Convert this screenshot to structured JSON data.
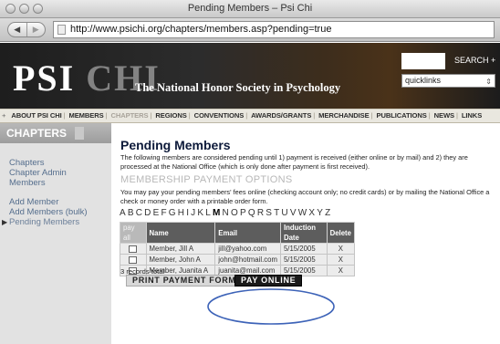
{
  "window": {
    "title": "Pending Members – Psi Chi"
  },
  "toolbar": {
    "back_label": "◀",
    "forward_label": "▶",
    "url": "http://www.psichi.org/chapters/members.asp?pending=true"
  },
  "banner": {
    "logo_psi": "PSI",
    "logo_chi": "CHI",
    "tagline": "The National Honor Society in Psychology",
    "search_label": "SEARCH +",
    "quicklinks_value": "quicklinks"
  },
  "nav": {
    "lead": "+",
    "items": [
      {
        "label": "ABOUT PSI CHI",
        "active": false
      },
      {
        "label": "MEMBERS",
        "active": false
      },
      {
        "label": "CHAPTERS",
        "active": true
      },
      {
        "label": "REGIONS",
        "active": false
      },
      {
        "label": "CONVENTIONS",
        "active": false
      },
      {
        "label": "AWARDS/GRANTS",
        "active": false
      },
      {
        "label": "MERCHANDISE",
        "active": false
      },
      {
        "label": "PUBLICATIONS",
        "active": false
      },
      {
        "label": "NEWS",
        "active": false
      },
      {
        "label": "LINKS",
        "active": false
      }
    ]
  },
  "sidebar": {
    "heading": "CHAPTERS",
    "links": [
      "Chapters",
      "Chapter Admin",
      "Members",
      "Add Member",
      "Add Members (bulk)",
      "Pending Members"
    ]
  },
  "main": {
    "title": "Pending Members",
    "intro": "The following members are considered pending until 1) payment is received (either online or by mail) and 2) they are processed at the National Office (which is only done after payment is first received).",
    "section_title": "MEMBERSHIP PAYMENT OPTIONS",
    "payment_text": "You may pay your pending members' fees online (checking account only; no credit cards) or by mailing the National Office a check or money order with a printable order form.",
    "letters": [
      "A",
      "B",
      "C",
      "D",
      "E",
      "F",
      "G",
      "H",
      "I",
      "J",
      "K",
      "L",
      "M",
      "N",
      "O",
      "P",
      "Q",
      "R",
      "S",
      "T",
      "U",
      "V",
      "W",
      "X",
      "Y",
      "Z"
    ],
    "selected_letter": "M",
    "table": {
      "headers": [
        "pay all",
        "Name",
        "Email",
        "Induction Date",
        "Delete"
      ],
      "rows": [
        {
          "name": "Member, Jill A",
          "email": "jill@yahoo.com",
          "date": "5/15/2005",
          "delete": "X"
        },
        {
          "name": "Member, John A",
          "email": "john@hotmail.com",
          "date": "5/15/2005",
          "delete": "X"
        },
        {
          "name": "Member, Juanita A",
          "email": "juanita@mail.com",
          "date": "5/15/2005",
          "delete": "X"
        }
      ]
    },
    "records_total": "3 records total",
    "print_button": "PRINT PAYMENT FORM",
    "pay_button": "PAY ONLINE"
  },
  "colors": {
    "highlight_circle": "#3d63b8",
    "table_header": "#5d5d5d",
    "sidebar_link": "#556e8d"
  }
}
